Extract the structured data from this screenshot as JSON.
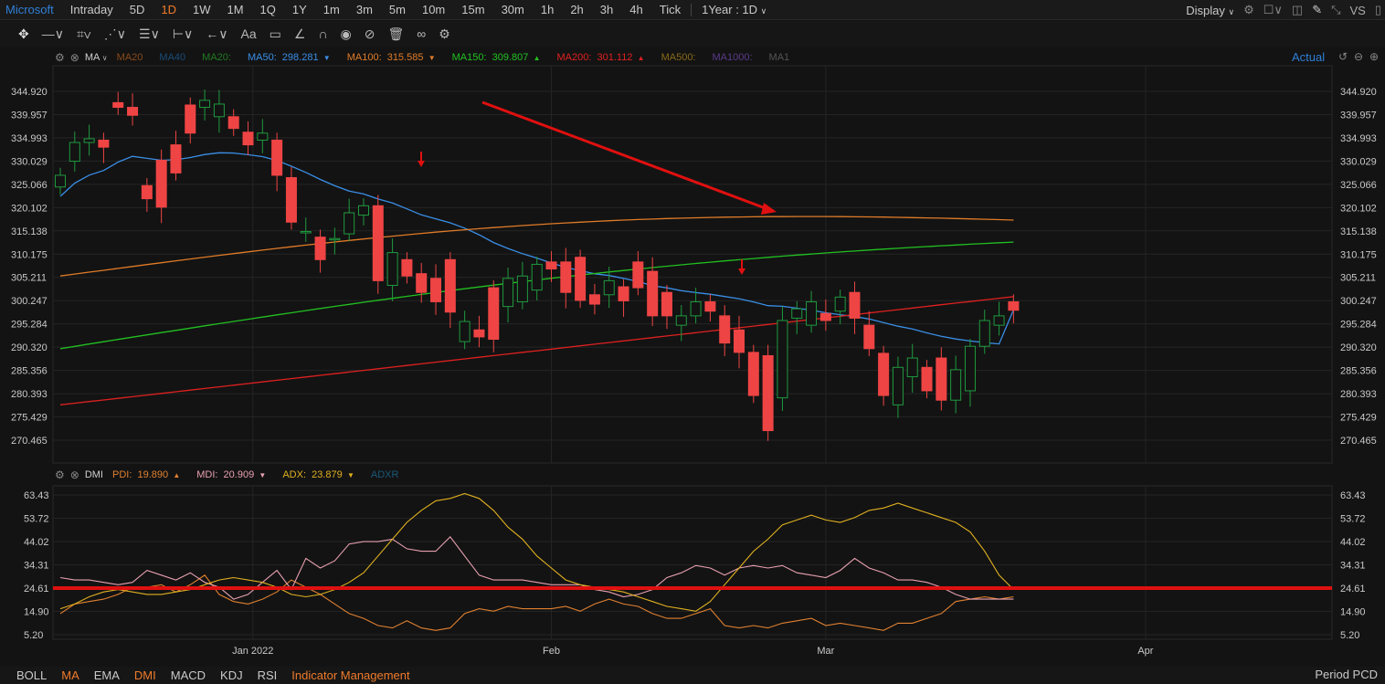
{
  "topbar": {
    "symbol": "Microsoft",
    "periods": [
      "Intraday",
      "5D",
      "1D",
      "1W",
      "1M",
      "1Q",
      "1Y",
      "1m",
      "3m",
      "5m",
      "10m",
      "15m",
      "30m",
      "1h",
      "2h",
      "3h",
      "4h",
      "Tick"
    ],
    "active_period": "1D",
    "range": "1Year : 1D",
    "display": "Display",
    "vs": "VS"
  },
  "toolbar": {
    "tools": [
      "move-icon",
      "line-icon",
      "rect-icon",
      "path-icon",
      "fib-icon",
      "measure-icon",
      "undo-icon",
      "text-icon",
      "comment-icon",
      "pen-icon",
      "magnet-icon",
      "eye-icon",
      "hide-icon",
      "trash-icon",
      "link-icon",
      "settings-icon"
    ],
    "text_tool": "Aa"
  },
  "ma_legend": {
    "name": "MA",
    "items": [
      {
        "label": "MA20",
        "value": "",
        "color": "#8a4a1a",
        "arrow": ""
      },
      {
        "label": "MA40",
        "value": "",
        "color": "#1a4d7a",
        "arrow": ""
      },
      {
        "label": "MA20:",
        "value": "",
        "color": "#1f7a1f",
        "arrow": ""
      },
      {
        "label": "MA50:",
        "value": "298.281",
        "color": "#3a8ee6",
        "arrow": "▼"
      },
      {
        "label": "MA100:",
        "value": "315.585",
        "color": "#e07b28",
        "arrow": "▼"
      },
      {
        "label": "MA150:",
        "value": "309.807",
        "color": "#22c022",
        "arrow": "▲"
      },
      {
        "label": "MA200:",
        "value": "301.112",
        "color": "#e02020",
        "arrow": "▲"
      },
      {
        "label": "MA500:",
        "value": "",
        "color": "#8a6a1a",
        "arrow": ""
      },
      {
        "label": "MA1000:",
        "value": "",
        "color": "#5a3a8a",
        "arrow": ""
      },
      {
        "label": "MA1",
        "value": "",
        "color": "#555555",
        "arrow": ""
      }
    ],
    "actual": "Actual"
  },
  "dmi_legend": {
    "name": "DMI",
    "items": [
      {
        "label": "PDI:",
        "value": "19.890",
        "color": "#e08030",
        "arrow": "▲"
      },
      {
        "label": "MDI:",
        "value": "20.909",
        "color": "#e8a0b0",
        "arrow": "▼"
      },
      {
        "label": "ADX:",
        "value": "23.879",
        "color": "#e0b020",
        "arrow": "▼"
      },
      {
        "label": "ADXR",
        "value": "",
        "color": "#1a5a7a",
        "arrow": ""
      }
    ]
  },
  "price_axis": [
    "344.920",
    "339.957",
    "334.993",
    "330.029",
    "325.066",
    "320.102",
    "315.138",
    "310.175",
    "305.211",
    "300.247",
    "295.284",
    "290.320",
    "285.356",
    "280.393",
    "275.429",
    "270.465"
  ],
  "dmi_axis": [
    "63.43",
    "53.72",
    "44.02",
    "34.31",
    "24.61",
    "14.90",
    "5.20"
  ],
  "date_axis": [
    "Jan 2022",
    "Feb",
    "Mar",
    "Apr"
  ],
  "colors": {
    "up": "#1f9a3f",
    "down": "#ef4444",
    "threshold": "#e01010",
    "grid": "#242424"
  },
  "chart_data": [
    {
      "type": "candlestick",
      "title": "",
      "ylim": [
        268,
        347
      ],
      "x": [
        "2021-12-13",
        "2021-12-14",
        "2021-12-15",
        "2021-12-16",
        "2021-12-17",
        "2021-12-20",
        "2021-12-21",
        "2021-12-22",
        "2021-12-23",
        "2021-12-27",
        "2021-12-28",
        "2021-12-29",
        "2021-12-30",
        "2021-12-31",
        "2022-01-03",
        "2022-01-04",
        "2022-01-05",
        "2022-01-06",
        "2022-01-07",
        "2022-01-10",
        "2022-01-11",
        "2022-01-12",
        "2022-01-13",
        "2022-01-14",
        "2022-01-18",
        "2022-01-19",
        "2022-01-20",
        "2022-01-21",
        "2022-01-24",
        "2022-01-25",
        "2022-01-26",
        "2022-01-27",
        "2022-01-28",
        "2022-01-31",
        "2022-02-01",
        "2022-02-02",
        "2022-02-03",
        "2022-02-04",
        "2022-02-07",
        "2022-02-08",
        "2022-02-09",
        "2022-02-10",
        "2022-02-11",
        "2022-02-14",
        "2022-02-15",
        "2022-02-16",
        "2022-02-17",
        "2022-02-18",
        "2022-02-22",
        "2022-02-23",
        "2022-02-24",
        "2022-02-25",
        "2022-02-28",
        "2022-03-01",
        "2022-03-02",
        "2022-03-03",
        "2022-03-04",
        "2022-03-07",
        "2022-03-08",
        "2022-03-09",
        "2022-03-10",
        "2022-03-11",
        "2022-03-14",
        "2022-03-15",
        "2022-03-16",
        "2022-03-17",
        "2022-03-18",
        "2022-03-21",
        "2022-03-22"
      ],
      "open": [
        324.5,
        330.0,
        334.0,
        334.5,
        342.5,
        341.5,
        324.8,
        330.2,
        333.5,
        342.0,
        341.5,
        339.5,
        339.5,
        336.2,
        334.5,
        334.5,
        326.5,
        315.0,
        313.8,
        313.5,
        314.5,
        318.5,
        320.5,
        303.5,
        309.0,
        306.0,
        305.0,
        309.0,
        291.5,
        294.0,
        303.0,
        299.0,
        300.0,
        302.5,
        308.5,
        308.5,
        309.5,
        301.5,
        301.5,
        303.2,
        308.5,
        306.5,
        302.0,
        295.0,
        297.0,
        300.0,
        297.0,
        294.0,
        289.2,
        288.5,
        279.5,
        296.5,
        295.0,
        297.5,
        298.0,
        302.0,
        295.0,
        289.0,
        278.0,
        284.0,
        286.0,
        288.0,
        279.0,
        281.0,
        290.5,
        295.0,
        300.0
      ],
      "close": [
        327.0,
        334.0,
        334.8,
        333.0,
        341.5,
        339.8,
        322.0,
        320.2,
        327.5,
        336.0,
        343.0,
        342.2,
        337.0,
        333.5,
        336.0,
        327.0,
        317.0,
        315.0,
        309.0,
        313.5,
        319.0,
        320.5,
        304.5,
        310.5,
        305.5,
        302.0,
        300.0,
        297.8,
        295.8,
        292.5,
        292.0,
        305.0,
        305.5,
        308.0,
        307.0,
        302.0,
        300.3,
        299.5,
        304.5,
        300.2,
        303.0,
        297.0,
        297.0,
        297.0,
        300.0,
        298.0,
        291.2,
        289.2,
        280.0,
        272.5,
        296.0,
        298.5,
        300.0,
        296.0,
        301.0,
        296.5,
        290.0,
        280.0,
        286.0,
        288.0,
        281.0,
        279.0,
        285.5,
        290.5,
        296.0,
        297.0,
        298.2
      ]
    },
    {
      "type": "line",
      "title": "",
      "ylim": [
        2,
        66
      ],
      "series": [
        {
          "name": "PDI",
          "values": [
            14,
            18,
            19,
            20,
            22,
            25,
            25,
            26,
            23,
            26,
            30,
            22,
            19,
            18,
            20,
            23,
            28,
            25,
            22,
            18,
            14,
            12,
            9,
            8,
            11,
            8,
            7,
            8,
            14,
            16,
            15,
            17,
            16,
            16,
            16,
            17,
            15,
            18,
            20,
            18,
            17,
            14,
            12,
            12,
            14,
            16,
            9,
            8,
            9,
            8,
            10,
            11,
            12,
            9,
            10,
            9,
            8,
            7,
            10,
            10,
            12,
            14,
            19,
            20,
            21,
            20,
            21
          ]
        },
        {
          "name": "MDI",
          "values": [
            29,
            28,
            28,
            27,
            26,
            27,
            32,
            30,
            28,
            31,
            27,
            25,
            20,
            22,
            27,
            32,
            24,
            37,
            33,
            36,
            43,
            44,
            44,
            45,
            41,
            40,
            40,
            46,
            38,
            30,
            28,
            28,
            28,
            27,
            26,
            26,
            26,
            24,
            23,
            21,
            22,
            24,
            29,
            31,
            34,
            33,
            30,
            33,
            34,
            33,
            34,
            31,
            30,
            29,
            32,
            37,
            33,
            31,
            28,
            28,
            27,
            25,
            22,
            20,
            20,
            20,
            20
          ]
        },
        {
          "name": "ADX",
          "values": [
            16,
            18,
            21,
            23,
            24,
            23,
            22,
            22,
            23,
            24,
            26,
            28,
            29,
            28,
            27,
            25,
            22,
            21,
            22,
            24,
            27,
            31,
            38,
            45,
            52,
            57,
            61,
            62,
            64,
            62,
            57,
            50,
            45,
            38,
            33,
            28,
            26,
            25,
            24,
            23,
            21,
            19,
            17,
            16,
            15,
            19,
            26,
            33,
            40,
            45,
            51,
            53,
            55,
            53,
            52,
            54,
            57,
            58,
            60,
            58,
            56,
            54,
            52,
            48,
            40,
            30,
            24
          ]
        }
      ],
      "threshold": 24.61
    }
  ],
  "bottombar": {
    "items": [
      "BOLL",
      "MA",
      "EMA",
      "DMI",
      "MACD",
      "KDJ",
      "RSI",
      "Indicator Management"
    ],
    "active": [
      "MA",
      "DMI",
      "Indicator Management"
    ],
    "period": "Period PCD"
  }
}
